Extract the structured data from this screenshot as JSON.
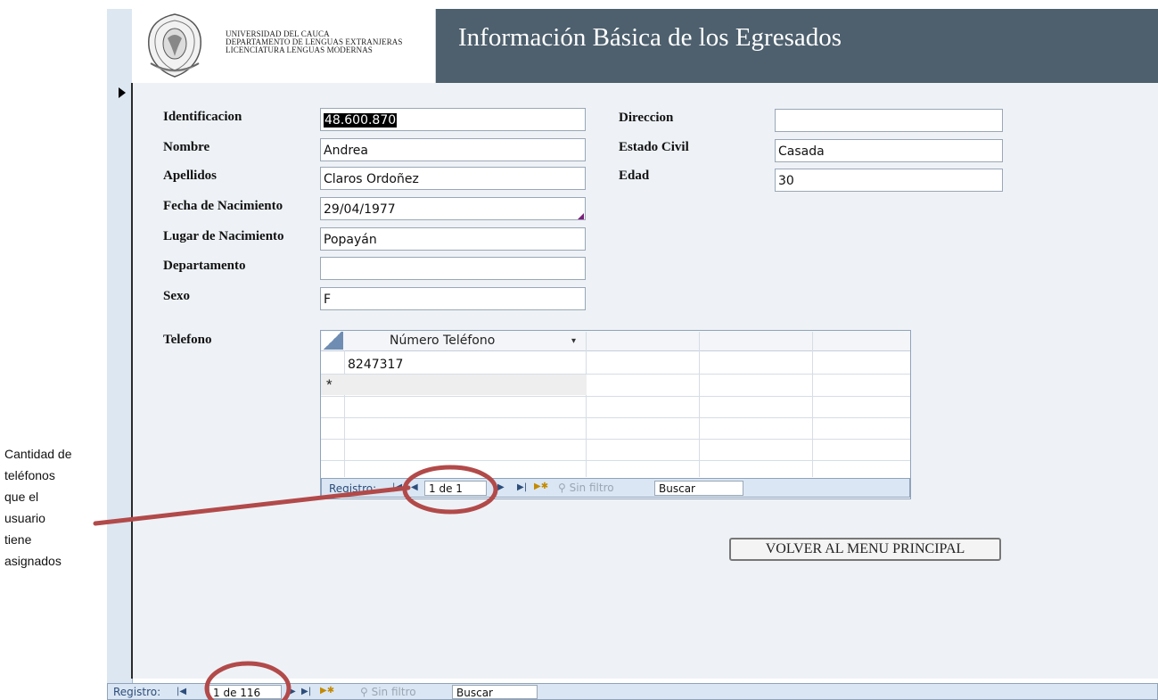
{
  "header": {
    "university_lines": [
      "UNIVERSIDAD DEL CAUCA",
      "DEPARTAMENTO DE LENGUAS EXTRANJERAS",
      "LICENCIATURA LENGUAS MODERNAS"
    ],
    "title": "Información Básica de los Egresados"
  },
  "form": {
    "identificacion": {
      "label": "Identificacion",
      "value": "48.600.870"
    },
    "nombre": {
      "label": "Nombre",
      "value": "Andrea"
    },
    "apellidos": {
      "label": "Apellidos",
      "value": "Claros Ordoñez"
    },
    "fecha_nacimiento": {
      "label": "Fecha de Nacimiento",
      "value": "29/04/1977"
    },
    "lugar_nacimiento": {
      "label": "Lugar de Nacimiento",
      "value": "Popayán"
    },
    "departamento": {
      "label": "Departamento",
      "value": ""
    },
    "sexo": {
      "label": "Sexo",
      "value": "F"
    },
    "direccion": {
      "label": "Direccion",
      "value": ""
    },
    "estado_civil": {
      "label": "Estado Civil",
      "value": "Casada"
    },
    "edad": {
      "label": "Edad",
      "value": "30"
    },
    "telefono_label": "Telefono"
  },
  "subform": {
    "column_header": "Número Teléfono",
    "rows": [
      "8247317"
    ],
    "new_row_marker": "*",
    "nav": {
      "label": "Registro:",
      "position": "1 de 1",
      "filter": "Sin filtro",
      "search": "Buscar"
    }
  },
  "main_nav": {
    "label": "Registro:",
    "position": "1 de 116",
    "filter": "Sin filtro",
    "search": "Buscar"
  },
  "menu_button_label": "VOLVER AL MENU PRINCIPAL",
  "annotation": {
    "lines": [
      "Cantidad de",
      "teléfonos",
      "que el",
      "usuario",
      "tiene",
      "asignados"
    ],
    "color": "#b24a4a"
  },
  "colors": {
    "header_bg": "#4e606e",
    "form_bg": "#eef2f6",
    "nav_bg": "#dae6f3"
  }
}
